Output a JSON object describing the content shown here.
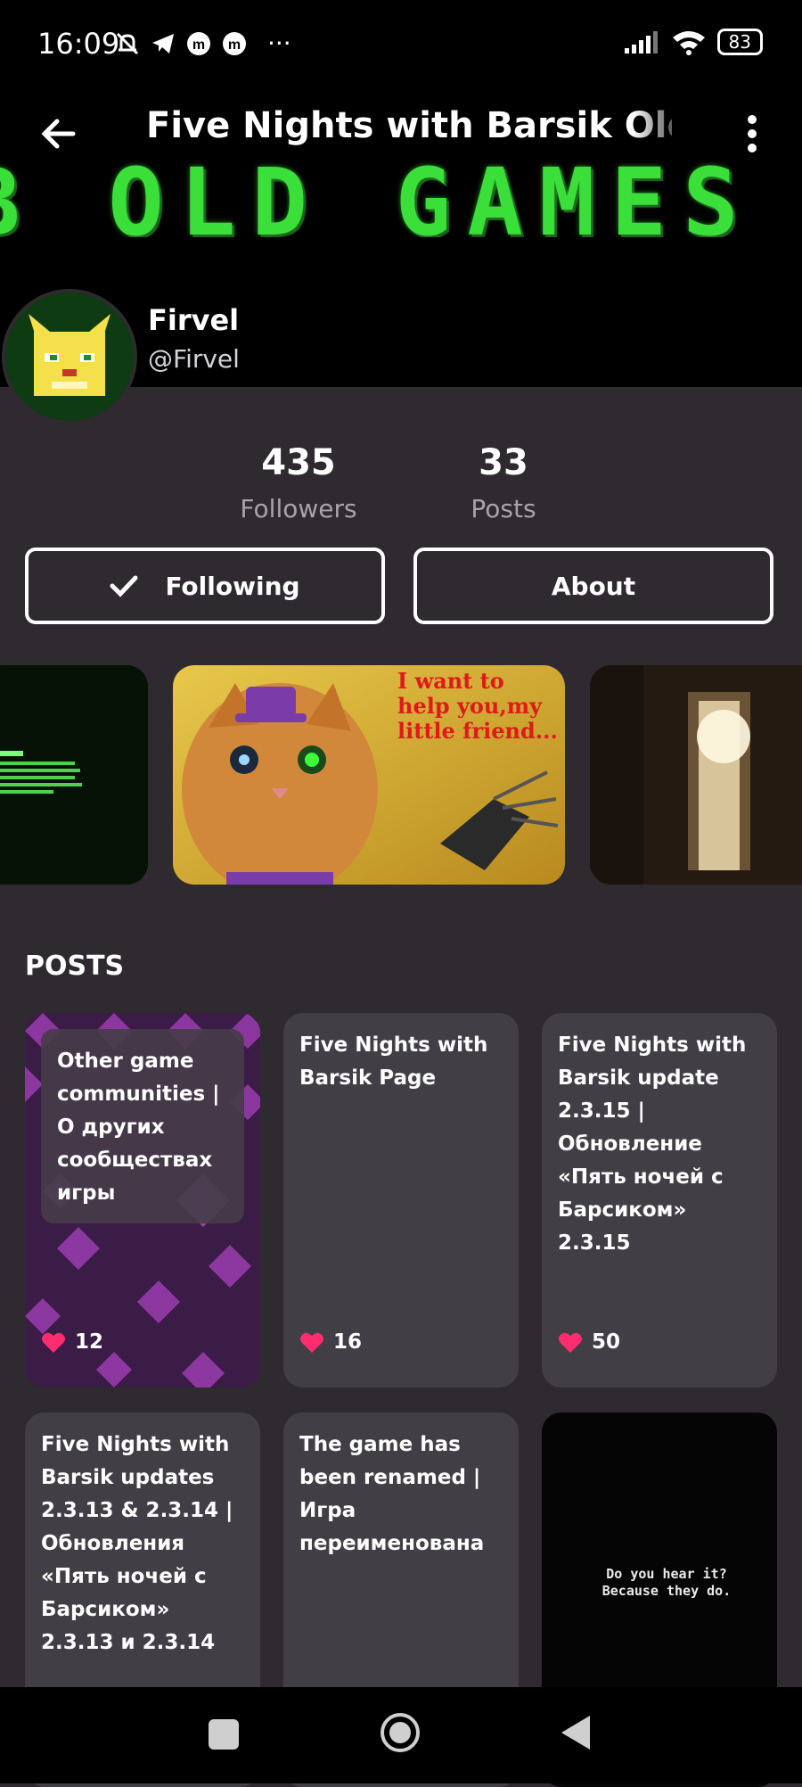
{
  "status_bar": {
    "time": "16:09",
    "battery": "83",
    "more": "···"
  },
  "app_bar": {
    "title": "Five Nights with Barsik Old Games Archive"
  },
  "banner": {
    "text": "B OLD GAMES ARCH"
  },
  "author": {
    "name": "Firvel",
    "handle": "@Firvel"
  },
  "stats": {
    "followers_value": "435",
    "followers_label": "Followers",
    "posts_value": "33",
    "posts_label": "Posts"
  },
  "actions": {
    "following_label": "Following",
    "about_label": "About"
  },
  "carousel": {
    "cat_caption": "I want to help you,my little friend..."
  },
  "section": {
    "posts_title": "POSTS"
  },
  "posts": [
    {
      "title": "Other game communities | О других сообществах игры",
      "likes": "12"
    },
    {
      "title": "Five Nights with Barsik Page",
      "likes": "16"
    },
    {
      "title": "Five Nights with Barsik update 2.3.15 | Обновление «Пять ночей с Барсиком» 2.3.15",
      "likes": "50"
    },
    {
      "title": "Five Nights with Barsik updates 2.3.13 & 2.3.14 | Обновления «Пять ночей с Барсиком» 2.3.13 и 2.3.14"
    },
    {
      "title": "The game has been renamed | Игра переименована"
    },
    {
      "title": "Do you hear it? Because they do."
    }
  ],
  "colors": {
    "background": "#2e2a30",
    "card": "#423e45",
    "heart": "#ff2d6f",
    "banner_green": "#3adf3a"
  }
}
